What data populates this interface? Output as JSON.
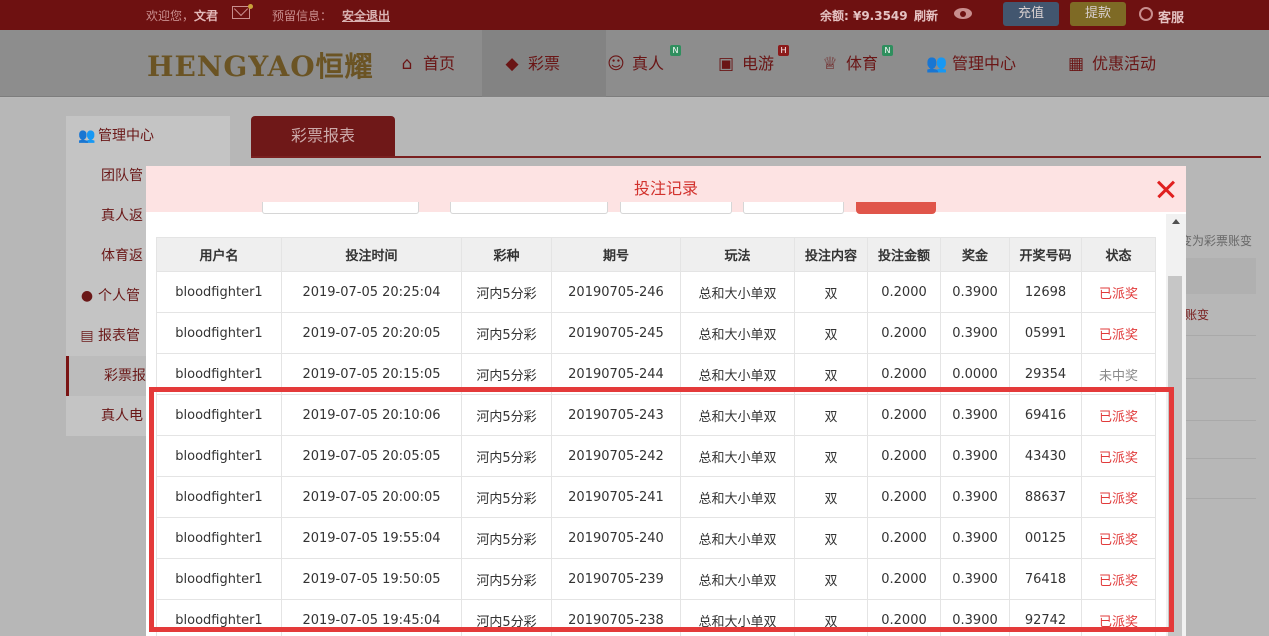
{
  "topbar": {
    "welcome": "欢迎您，",
    "username": "文君",
    "notice_label": "预留信息：",
    "logout": "安全退出",
    "balance_label": "余额: ¥",
    "balance_value": "9.3549",
    "refresh": "刷新",
    "recharge": "充值",
    "withdraw": "提款",
    "customer_service": "客服"
  },
  "logo": {
    "text": "HENGYAO恒耀"
  },
  "nav": {
    "items": [
      {
        "label": "首页",
        "icon": "home-icon",
        "glyph": "⌂"
      },
      {
        "label": "彩票",
        "icon": "lottery-ticket-icon",
        "glyph": "◆"
      },
      {
        "label": "真人",
        "icon": "live-dealer-icon",
        "glyph": "☺",
        "badge": "N"
      },
      {
        "label": "电游",
        "icon": "slot-machine-icon",
        "glyph": "▣",
        "badge": "H"
      },
      {
        "label": "体育",
        "icon": "trophy-icon",
        "glyph": "♕",
        "badge": "N"
      },
      {
        "label": "管理中心",
        "icon": "users-icon",
        "glyph": "👥"
      },
      {
        "label": "优惠活动",
        "icon": "gift-icon",
        "glyph": "▦"
      }
    ]
  },
  "sidebar": {
    "items": [
      {
        "label": "管理中心",
        "type": "head",
        "icon": "users-icon",
        "glyph": "👥"
      },
      {
        "label": "团队管",
        "type": "sub"
      },
      {
        "label": "真人返",
        "type": "sub"
      },
      {
        "label": "体育返",
        "type": "sub"
      },
      {
        "label": "个人管",
        "type": "head",
        "icon": "person-icon",
        "glyph": "●"
      },
      {
        "label": "报表管",
        "type": "head",
        "icon": "report-icon",
        "glyph": "▤"
      },
      {
        "label": "彩票报",
        "type": "sub",
        "selected": true
      },
      {
        "label": "真人电",
        "type": "sub"
      }
    ]
  },
  "content": {
    "tab": "彩票报表",
    "note": "变为彩票账变",
    "cell": "账变"
  },
  "modal": {
    "title": "投注记录",
    "columns": [
      "用户名",
      "投注时间",
      "彩种",
      "期号",
      "玩法",
      "投注内容",
      "投注金额",
      "奖金",
      "开奖号码",
      "状态"
    ],
    "rows": [
      {
        "user": "bloodfighter1",
        "time": "2019-07-05 20:25:04",
        "lottery": "河内5分彩",
        "issue": "20190705-246",
        "play": "总和大小单双",
        "content": "双",
        "amount": "0.2000",
        "prize": "0.3900",
        "number": "12698",
        "status": "已派奖",
        "status_color": "red"
      },
      {
        "user": "bloodfighter1",
        "time": "2019-07-05 20:20:05",
        "lottery": "河内5分彩",
        "issue": "20190705-245",
        "play": "总和大小单双",
        "content": "双",
        "amount": "0.2000",
        "prize": "0.3900",
        "number": "05991",
        "status": "已派奖",
        "status_color": "red"
      },
      {
        "user": "bloodfighter1",
        "time": "2019-07-05 20:15:05",
        "lottery": "河内5分彩",
        "issue": "20190705-244",
        "play": "总和大小单双",
        "content": "双",
        "amount": "0.2000",
        "prize": "0.0000",
        "number": "29354",
        "status": "未中奖",
        "status_color": "gray"
      },
      {
        "user": "bloodfighter1",
        "time": "2019-07-05 20:10:06",
        "lottery": "河内5分彩",
        "issue": "20190705-243",
        "play": "总和大小单双",
        "content": "双",
        "amount": "0.2000",
        "prize": "0.3900",
        "number": "69416",
        "status": "已派奖",
        "status_color": "red"
      },
      {
        "user": "bloodfighter1",
        "time": "2019-07-05 20:05:05",
        "lottery": "河内5分彩",
        "issue": "20190705-242",
        "play": "总和大小单双",
        "content": "双",
        "amount": "0.2000",
        "prize": "0.3900",
        "number": "43430",
        "status": "已派奖",
        "status_color": "red"
      },
      {
        "user": "bloodfighter1",
        "time": "2019-07-05 20:00:05",
        "lottery": "河内5分彩",
        "issue": "20190705-241",
        "play": "总和大小单双",
        "content": "双",
        "amount": "0.2000",
        "prize": "0.3900",
        "number": "88637",
        "status": "已派奖",
        "status_color": "red"
      },
      {
        "user": "bloodfighter1",
        "time": "2019-07-05 19:55:04",
        "lottery": "河内5分彩",
        "issue": "20190705-240",
        "play": "总和大小单双",
        "content": "双",
        "amount": "0.2000",
        "prize": "0.3900",
        "number": "00125",
        "status": "已派奖",
        "status_color": "red"
      },
      {
        "user": "bloodfighter1",
        "time": "2019-07-05 19:50:05",
        "lottery": "河内5分彩",
        "issue": "20190705-239",
        "play": "总和大小单双",
        "content": "双",
        "amount": "0.2000",
        "prize": "0.3900",
        "number": "76418",
        "status": "已派奖",
        "status_color": "red"
      },
      {
        "user": "bloodfighter1",
        "time": "2019-07-05 19:45:04",
        "lottery": "河内5分彩",
        "issue": "20190705-238",
        "play": "总和大小单双",
        "content": "双",
        "amount": "0.2000",
        "prize": "0.3900",
        "number": "92742",
        "status": "已派奖",
        "status_color": "red"
      }
    ]
  },
  "colors": {
    "status_red": "#e13b3b",
    "status_gray": "#8a8a8a",
    "modal_title": "#d2322d",
    "highlight": "#e43a3a"
  }
}
